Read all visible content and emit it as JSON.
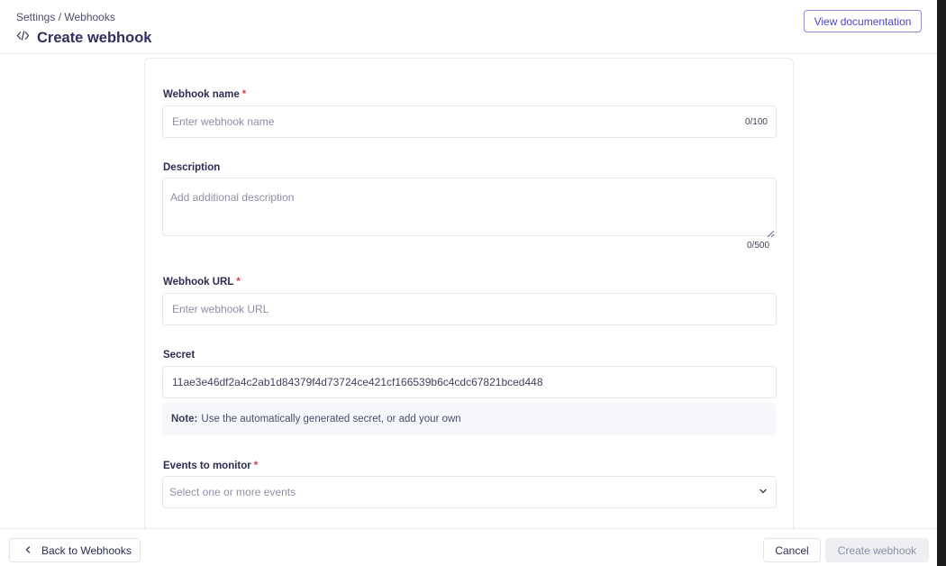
{
  "header": {
    "breadcrumb": "Settings / Webhooks",
    "title": "Create webhook",
    "title_icon": "code-icon",
    "doc_button": "View documentation"
  },
  "form": {
    "name": {
      "label": "Webhook name",
      "required_mark": "*",
      "placeholder": "Enter webhook name",
      "value": "",
      "counter": "0/100"
    },
    "description": {
      "label": "Description",
      "placeholder": "Add additional description",
      "value": "",
      "counter": "0/500"
    },
    "url": {
      "label": "Webhook URL",
      "required_mark": "*",
      "placeholder": "Enter webhook URL",
      "value": ""
    },
    "secret": {
      "label": "Secret",
      "value": "11ae3e46df2a4c2ab1d84379f4d73724ce421cf166539b6c4cdc67821bced448"
    },
    "note": {
      "prefix": "Note:",
      "text": "Use the automatically generated secret, or add your own"
    },
    "events": {
      "label": "Events to monitor",
      "required_mark": "*",
      "placeholder": "Select one or more events"
    }
  },
  "footer": {
    "back_label": "Back to Webhooks",
    "cancel_label": "Cancel",
    "create_label": "Create webhook"
  },
  "colors": {
    "accent": "#4e46c8",
    "required": "#e0384b",
    "disabled_bg": "#eeeff3"
  }
}
